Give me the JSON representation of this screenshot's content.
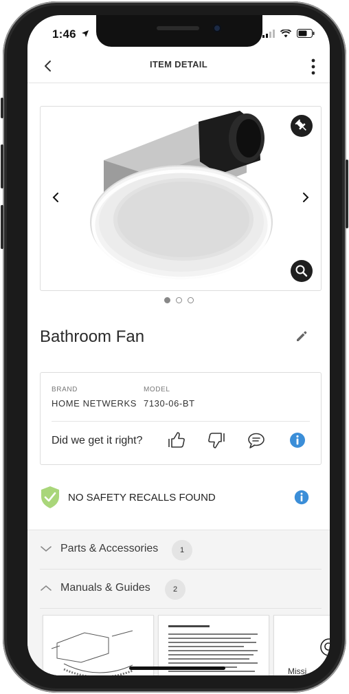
{
  "status_bar": {
    "time": "1:46"
  },
  "nav": {
    "title": "ITEM DETAIL"
  },
  "item": {
    "title": "Bathroom Fan"
  },
  "carousel": {
    "pages": 3,
    "active": 1
  },
  "details": {
    "brand_label": "BRAND",
    "brand_value": "HOME NETWERKS",
    "model_label": "MODEL",
    "model_value": "7130-06-BT",
    "feedback_question": "Did we get it right?"
  },
  "safety": {
    "text": "NO SAFETY RECALLS FOUND"
  },
  "sections": [
    {
      "label": "Parts & Accessories",
      "count": "1",
      "expanded": false
    },
    {
      "label": "Manuals & Guides",
      "count": "2",
      "expanded": true
    }
  ],
  "manual_cards": [
    {
      "caption": ""
    },
    {
      "caption": ""
    },
    {
      "caption": "Missi"
    }
  ],
  "colors": {
    "info_blue": "#3b8ed8",
    "shield_green": "#a9d67a",
    "dark": "#1f1f1f"
  }
}
